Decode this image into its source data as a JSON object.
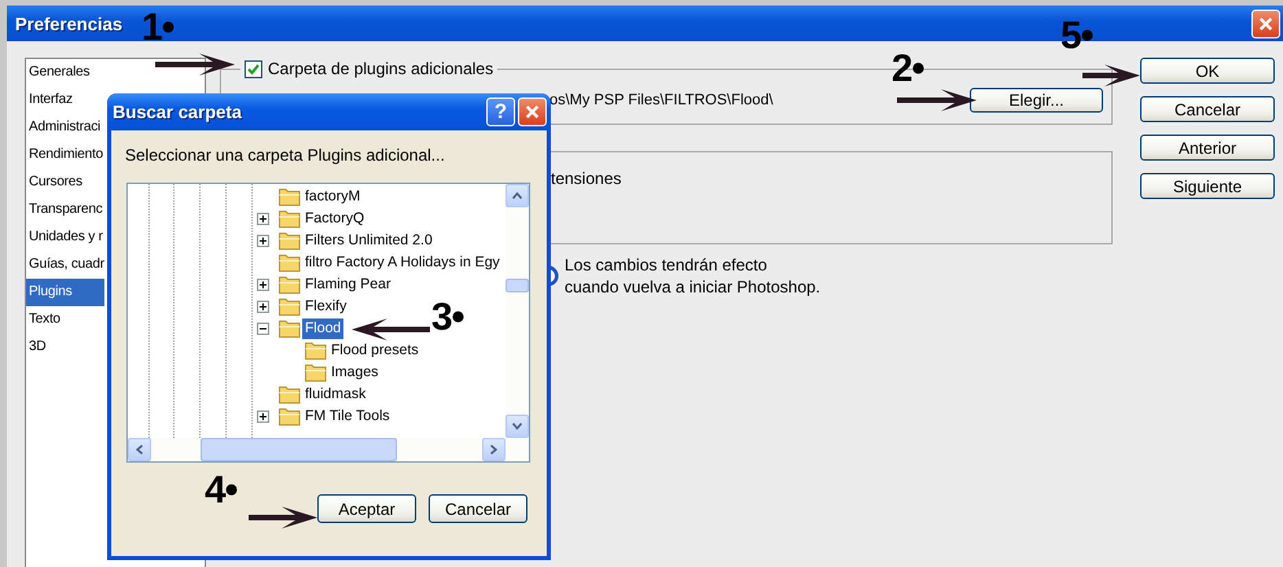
{
  "window": {
    "title": "Preferencias"
  },
  "categories": [
    {
      "label": "Generales",
      "selected": false
    },
    {
      "label": "Interfaz",
      "selected": false
    },
    {
      "label": "Administraci",
      "selected": false
    },
    {
      "label": "Rendimiento",
      "selected": false
    },
    {
      "label": "Cursores",
      "selected": false
    },
    {
      "label": "Transparenc",
      "selected": false
    },
    {
      "label": "Unidades y r",
      "selected": false
    },
    {
      "label": "Guías, cuadr",
      "selected": false
    },
    {
      "label": "Plugins",
      "selected": true
    },
    {
      "label": "Texto",
      "selected": false
    },
    {
      "label": "3D",
      "selected": false
    }
  ],
  "plugins_folder": {
    "label": "Carpeta de plugins adicionales",
    "checked": true,
    "path": "os\\My PSP Files\\FILTROS\\Flood\\",
    "button": "Elegir..."
  },
  "extensions_group": {
    "text": "tensiones"
  },
  "notice": [
    "Los cambios tendrán efecto",
    "cuando vuelva a iniciar Photoshop."
  ],
  "buttons": [
    "OK",
    "Cancelar",
    "Anterior",
    "Siguiente"
  ],
  "dialog": {
    "title": "Buscar carpeta",
    "help_button": "?",
    "prompt": "Seleccionar una carpeta Plugins adicional...",
    "tree": [
      {
        "label": "factoryM",
        "kind": "leaf",
        "selected": false
      },
      {
        "label": "FactoryQ",
        "kind": "collapsed",
        "selected": false
      },
      {
        "label": "Filters Unlimited 2.0",
        "kind": "collapsed",
        "selected": false
      },
      {
        "label": "filtro Factory A Holidays in Egy",
        "kind": "leaf",
        "selected": false
      },
      {
        "label": "Flaming Pear",
        "kind": "collapsed",
        "selected": false
      },
      {
        "label": "Flexify",
        "kind": "collapsed",
        "selected": false
      },
      {
        "label": "Flood",
        "kind": "expanded",
        "selected": true,
        "children": [
          {
            "label": "Flood presets",
            "kind": "leaf",
            "selected": false
          },
          {
            "label": "Images",
            "kind": "leaf",
            "selected": false
          }
        ]
      },
      {
        "label": "fluidmask",
        "kind": "leaf",
        "selected": false
      },
      {
        "label": "FM Tile Tools",
        "kind": "collapsed",
        "selected": false
      }
    ],
    "buttons": [
      "Aceptar",
      "Cancelar"
    ]
  },
  "annotations": [
    {
      "label": "1•",
      "kind": "right"
    },
    {
      "label": "2•",
      "kind": "right"
    },
    {
      "label": "3•",
      "kind": "left"
    },
    {
      "label": "4•",
      "kind": "right"
    },
    {
      "label": "5•",
      "kind": "right"
    }
  ]
}
